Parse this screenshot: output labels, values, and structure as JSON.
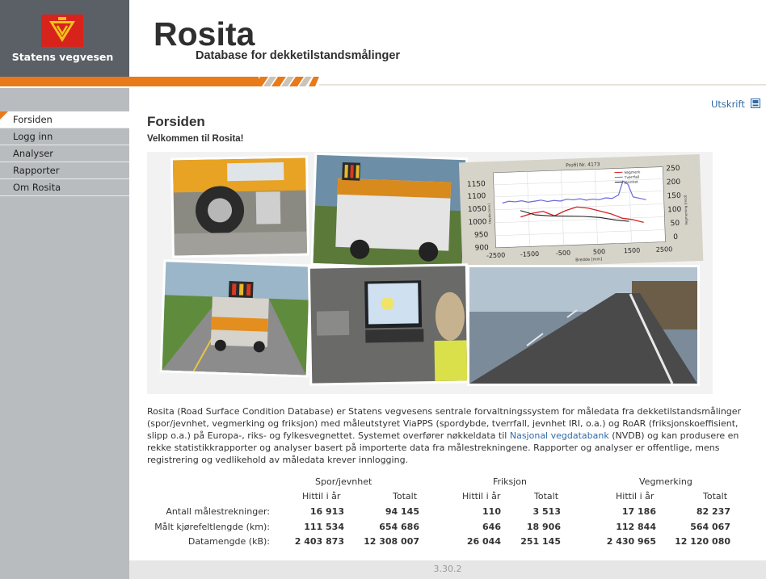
{
  "header": {
    "org_name": "Statens vegvesen",
    "app_title": "Rosita",
    "app_subtitle": "Database for dekketilstandsmålinger"
  },
  "sidebar": {
    "items": [
      {
        "label": "Forsiden",
        "active": true
      },
      {
        "label": "Logg inn",
        "active": false
      },
      {
        "label": "Analyser",
        "active": false
      },
      {
        "label": "Rapporter",
        "active": false
      },
      {
        "label": "Om Rosita",
        "active": false
      }
    ]
  },
  "main": {
    "print_label": "Utskrift",
    "title": "Forsiden",
    "welcome": "Velkommen til Rosita!",
    "intro_before_link": "Rosita (Road Surface Condition Database) er Statens vegvesens sentrale forvaltningssystem for måledata fra dekketilstandsmålinger (spor/jevnhet, vegmerking og friksjon) med måleutstyret ViaPPS (spordybde, tverrfall, jevnhet IRI, o.a.) og RoAR (friksjonskoeffisient, slipp o.a.) på Europa-, riks- og fylkesvegnettet. Systemet overfører nøkkeldata til",
    "intro_link": "Nasjonal vegdatabank",
    "intro_after_link": "(NVDB) og kan produsere en rekke statistikkrapporter og analyser basert på importerte data fra målestrekningene. Rapporter og analyser er offentlige, mens registrering og vedlikehold av måledata krever innlogging."
  },
  "collage_chart": {
    "title": "Profil Nr. 4173",
    "legend": [
      "Vegmerk",
      "Tverrfall",
      "Jevnhet"
    ],
    "left_ticks": [
      "1150",
      "1100",
      "1050",
      "1000",
      "950",
      "900"
    ],
    "right_ticks": [
      "250",
      "200",
      "150",
      "100",
      "50",
      "0"
    ],
    "x_ticks": [
      "-2500",
      "-1500",
      "-500",
      "500",
      "1500",
      "2500"
    ],
    "x_label": "Bredde [mm]",
    "left_axis_label": "Høyde [mm]",
    "right_axis_label": "Vegmerking [mcd]",
    "colors": {
      "red": "#d42020",
      "blue": "#6a6adc",
      "black": "#222222"
    }
  },
  "stats": {
    "groups": [
      "Spor/jevnhet",
      "Friksjon",
      "Vegmerking"
    ],
    "sub_headers": [
      "Hittil i år",
      "Totalt"
    ],
    "rows": [
      {
        "label": "Antall målestrekninger:",
        "values": [
          "16 913",
          "94 145",
          "110",
          "3 513",
          "17 186",
          "82 237"
        ]
      },
      {
        "label": "Målt kjørefeltlengde (km):",
        "values": [
          "111 534",
          "654 686",
          "646",
          "18 906",
          "112 844",
          "564 067"
        ]
      },
      {
        "label": "Datamengde (kB):",
        "values": [
          "2 403 873",
          "12 308 007",
          "26 044",
          "251 145",
          "2 430 965",
          "12 120 080"
        ]
      }
    ]
  },
  "footer": {
    "version": "3.30.2"
  },
  "colors": {
    "accent_orange": "#e87a1a",
    "sidebar_bg": "#b9bcbf",
    "logo_bg": "#5b6066",
    "link_blue": "#2f6aa8"
  }
}
